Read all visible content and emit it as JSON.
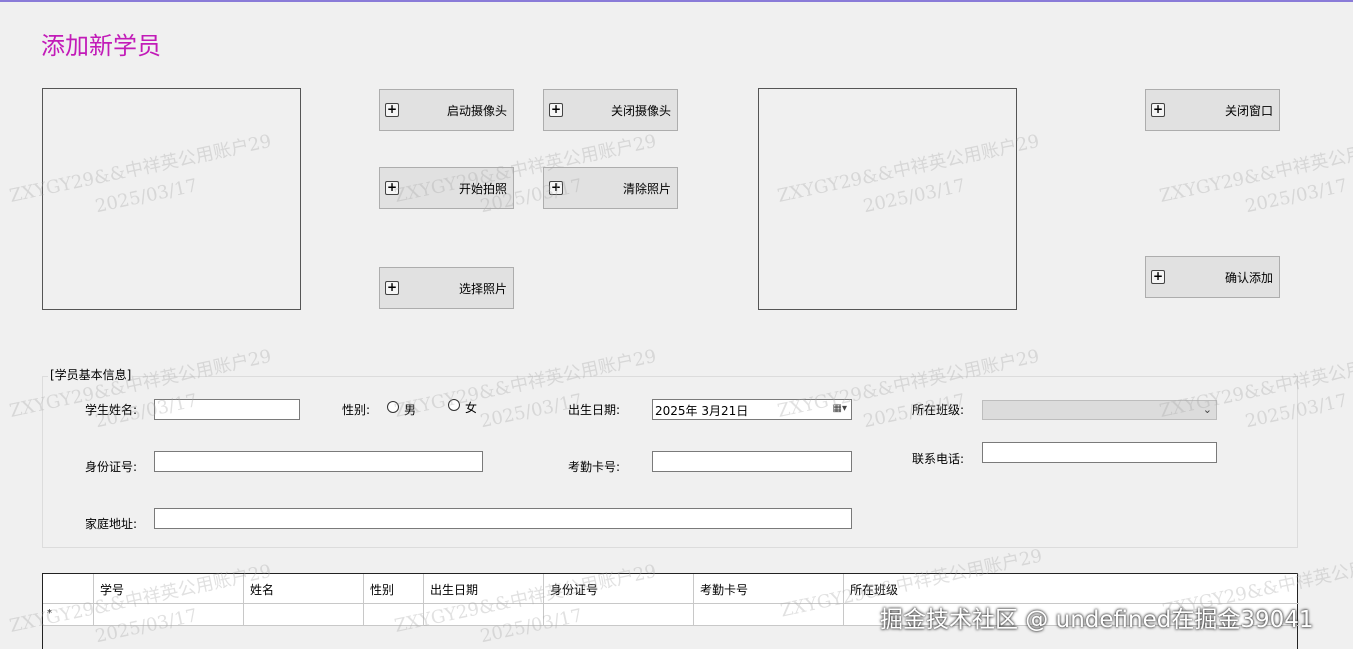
{
  "window": {
    "title": "添加新学员"
  },
  "buttons": {
    "start_camera": "启动摄像头",
    "close_camera": "关闭摄像头",
    "take_photo": "开始拍照",
    "clear_photo": "清除照片",
    "select_photo": "选择照片",
    "close_window": "关闭窗口",
    "confirm_add": "确认添加"
  },
  "form": {
    "group_title": "[学员基本信息]",
    "name_label": "学生姓名:",
    "name_value": "",
    "gender_label": "性别:",
    "gender_male": "男",
    "gender_female": "女",
    "birth_label": "出生日期:",
    "birth_value": "2025年  3月21日",
    "class_label": "所在班级:",
    "class_value": "",
    "idcard_label": "身份证号:",
    "idcard_value": "",
    "attendance_label": "考勤卡号:",
    "attendance_value": "",
    "phone_label": "联系电话:",
    "phone_value": "",
    "address_label": "家庭地址:",
    "address_value": ""
  },
  "grid": {
    "columns": [
      "学号",
      "姓名",
      "性别",
      "出生日期",
      "身份证号",
      "考勤卡号",
      "所在班级"
    ],
    "new_row_marker": "*"
  },
  "watermark": {
    "line1": "ZXYGY29&&中祥英公用账户29",
    "line2": "2025/03/17"
  },
  "overlay": {
    "text": "掘金技术社区 @ undefined在掘金39041"
  },
  "icons": {
    "button_icon": "plus-icon",
    "date_icon": "calendar-icon",
    "combo_icon": "chevron-down-icon"
  }
}
